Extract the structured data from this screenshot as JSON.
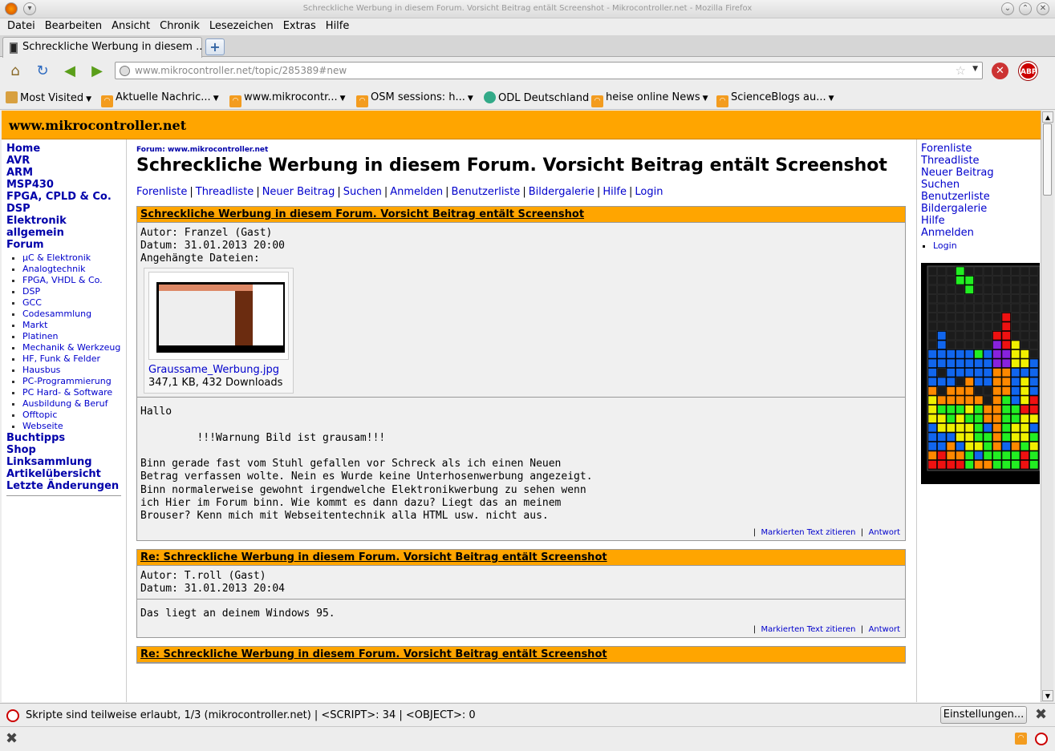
{
  "window": {
    "title": "Schreckliche Werbung in diesem Forum. Vorsicht Beitrag entält Screenshot - Mikrocontroller.net - Mozilla Firefox",
    "min": "⌄",
    "max": "⌃",
    "close": "✕"
  },
  "menu": [
    "Datei",
    "Bearbeiten",
    "Ansicht",
    "Chronik",
    "Lesezeichen",
    "Extras",
    "Hilfe"
  ],
  "tab": {
    "label": "Schreckliche Werbung in diesem ...",
    "new_tab": "+"
  },
  "nav": {
    "url_domain": "www.mikrocontroller.net",
    "url_path": "/topic/285389#new",
    "abp": "ABP"
  },
  "bookmarks": [
    "Most Visited",
    "Aktuelle Nachric...",
    "www.mikrocontr...",
    "OSM sessions: h...",
    "ODL Deutschland",
    "heise online News",
    "ScienceBlogs au..."
  ],
  "site": {
    "name": "www.mikrocontroller.net"
  },
  "leftnav": {
    "top": [
      "Home",
      "AVR",
      "ARM",
      "MSP430",
      "FPGA, CPLD & Co.",
      "DSP",
      "Elektronik allgemein",
      "Forum"
    ],
    "forum": [
      "µC & Elektronik",
      "Analogtechnik",
      "FPGA, VHDL & Co.",
      "DSP",
      "GCC",
      "Codesammlung",
      "Markt",
      "Platinen",
      "Mechanik & Werkzeug",
      "HF, Funk & Felder",
      "Hausbus",
      "PC-Programmierung",
      "PC Hard- & Software",
      "Ausbildung & Beruf",
      "Offtopic",
      "Webseite"
    ],
    "bottom": [
      "Buchtipps",
      "Shop",
      "Linksammlung",
      "Artikelübersicht",
      "Letzte Änderungen"
    ]
  },
  "content": {
    "crumb_prefix": "Forum:",
    "crumb_link": "www.mikrocontroller.net",
    "title": "Schreckliche Werbung in diesem Forum. Vorsicht Beitrag entält Screenshot",
    "links": [
      "Forenliste",
      "Threadliste",
      "Neuer Beitrag",
      "Suchen",
      "Anmelden",
      "Benutzerliste",
      "Bildergalerie",
      "Hilfe",
      "Login"
    ]
  },
  "posts": [
    {
      "subject": "Schreckliche Werbung in diesem Forum. Vorsicht Beitrag entält Screenshot",
      "author": "Autor: Franzel (Gast)",
      "date": "Datum: 31.01.2013 20:00",
      "attach_label": "Angehängte Dateien:",
      "file_name": "Graussame_Werbung.jpg",
      "file_info": "347,1 KB, 432 Downloads",
      "body": "Hallo\n\n         !!!Warnung Bild ist grausam!!!\n\nBinn gerade fast vom Stuhl gefallen vor Schreck als ich einen Neuen\nBetrag verfassen wolte. Nein es Wurde keine Unterhosenwerbung angezeigt.\nBinn normalerweise gewohnt irgendwelche Elektronikwerbung zu sehen wenn\nich Hier im Forum binn. Wie kommt es dann dazu? Liegt das an meinem\nBrouser? Kenn mich mit Webseitentechnik alla HTML usw. nicht aus.\n",
      "quote": "Markierten Text zitieren",
      "reply": "Antwort"
    },
    {
      "subject": "Re: Schreckliche Werbung in diesem Forum. Vorsicht Beitrag entält Screenshot",
      "author": "Autor: T.roll (Gast)",
      "date": "Datum: 31.01.2013 20:04",
      "body": "Das liegt an deinem Windows 95.\n",
      "quote": "Markierten Text zitieren",
      "reply": "Antwort"
    },
    {
      "subject": "Re: Schreckliche Werbung in diesem Forum. Vorsicht Beitrag entält Screenshot"
    }
  ],
  "rightnav": {
    "links": [
      "Forenliste",
      "Threadliste",
      "Neuer Beitrag",
      "Suchen",
      "Benutzerliste",
      "Bildergalerie",
      "Hilfe",
      "Anmelden"
    ],
    "sub": [
      "Login"
    ]
  },
  "tetris": {
    "rows": [
      "...G........",
      "...GG.......",
      "....G.......",
      "............",
      "............",
      "........R...",
      "........R...",
      ".B.....RR...",
      ".B.....PRY..",
      "BBBBBGBPPYY.",
      "BBBBBBBPPYYB",
      "B.BBBBBOOBBB",
      "BBB.OBBOOBYB",
      "O.OOO..OOBYB",
      "YOOOOO.OGBYR",
      "YGGGYGOOGGRR",
      "YYGYGGOOGGYY",
      "BYYYYGBOGYYB",
      "BBBYYGGOGYYG",
      "BBOBYYGOBOGY",
      "OROOGBGGGGRG",
      "RRRRGOOGGGRG"
    ],
    "colors": {
      "G": "#22ee22",
      "R": "#ee1111",
      "B": "#1166ee",
      "P": "#8822dd",
      "Y": "#f0f000",
      "O": "#ff8800"
    }
  },
  "status": {
    "text": "Skripte sind teilweise erlaubt, 1/3 (mikrocontroller.net) | <SCRIPT>: 34 | <OBJECT>: 0",
    "button": "Einstellungen..."
  }
}
